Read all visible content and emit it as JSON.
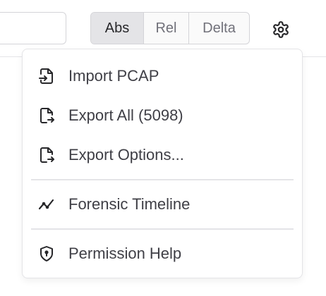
{
  "toolbar": {
    "search": {
      "value": ""
    },
    "mode_toggle": {
      "options": [
        "Abs",
        "Rel",
        "Delta"
      ],
      "selected": "Abs"
    },
    "settings_icon": "gear-icon"
  },
  "menu": {
    "items": [
      {
        "label": "Import PCAP",
        "icon": "file-import-icon"
      },
      {
        "label": "Export All (5098)",
        "icon": "file-export-icon"
      },
      {
        "label": "Export Options...",
        "icon": "file-export-icon"
      },
      {
        "label": "Forensic Timeline",
        "icon": "activity-icon"
      },
      {
        "label": "Permission Help",
        "icon": "shield-icon"
      }
    ]
  },
  "colors": {
    "text": "#3f3f46",
    "icon": "#27272a",
    "border": "#d4d4d8",
    "active_segment": "#e4e4e7",
    "separator": "#e4e4e7"
  }
}
